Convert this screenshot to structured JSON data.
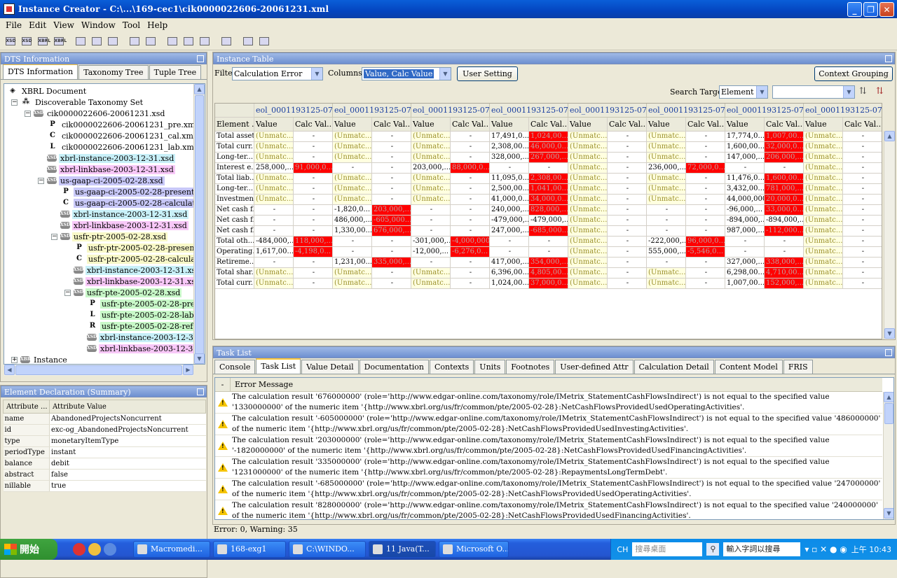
{
  "window": {
    "title": "Instance Creator - C:\\...\\169-cec1\\cik0000022606-20061231.xml"
  },
  "menu": [
    "File",
    "Edit",
    "View",
    "Window",
    "Tool",
    "Help"
  ],
  "toolbar": [
    {
      "icon": "xsd-icon",
      "label": "XSD"
    },
    {
      "icon": "xsd-new-icon",
      "label": "XSD"
    },
    {
      "icon": "xbrl-icon",
      "label": "XBRL"
    },
    {
      "icon": "xbrl-new-icon",
      "label": "XBRL"
    },
    {
      "icon": "save-icon",
      "label": ""
    },
    {
      "icon": "print-icon",
      "label": ""
    },
    {
      "icon": "validate-icon",
      "label": ""
    },
    {
      "icon": "undo-icon",
      "label": ""
    },
    {
      "icon": "redo-icon",
      "label": ""
    },
    {
      "icon": "add-element-icon",
      "label": ""
    },
    {
      "icon": "add-context-icon",
      "label": ""
    },
    {
      "icon": "add-unit-icon",
      "label": ""
    },
    {
      "icon": "inspect-icon",
      "label": ""
    },
    {
      "icon": "import-icon",
      "label": ""
    },
    {
      "icon": "export-icon",
      "label": ""
    }
  ],
  "dts": {
    "pane_title": "DTS Information",
    "tabs": [
      "DTS Information",
      "Taxonomy Tree",
      "Tuple Tree"
    ],
    "tree": [
      {
        "label": "XBRL Document",
        "icon": "xbrl-document-icon",
        "glyph": "◈",
        "indent": 0,
        "hl": ""
      },
      {
        "label": "Discoverable Taxonomy Set",
        "icon": "taxonomy-set-icon",
        "glyph": "⁂",
        "indent": 1,
        "hl": ""
      },
      {
        "label": "cik0000022606-20061231.xsd",
        "icon": "xsd-file-icon",
        "glyph": "XSD",
        "indent": 2,
        "hl": ""
      },
      {
        "label": "cik0000022606-20061231_pre.xml",
        "icon": "presentation-linkbase-icon",
        "glyph": "P",
        "indent": 3,
        "hl": ""
      },
      {
        "label": "cik0000022606-20061231_cal.xml",
        "icon": "calculation-linkbase-icon",
        "glyph": "C",
        "indent": 3,
        "hl": ""
      },
      {
        "label": "cik0000022606-20061231_lab.xml",
        "icon": "label-linkbase-icon",
        "glyph": "L",
        "indent": 3,
        "hl": ""
      },
      {
        "label": "xbrl-instance-2003-12-31.xsd",
        "icon": "xsd-file-icon",
        "glyph": "XSD",
        "indent": 3,
        "hl": "c"
      },
      {
        "label": "xbrl-linkbase-2003-12-31.xsd",
        "icon": "xsd-file-icon",
        "glyph": "XSD",
        "indent": 3,
        "hl": "m"
      },
      {
        "label": "us-gaap-ci-2005-02-28.xsd",
        "icon": "xsd-file-icon",
        "glyph": "XSD",
        "indent": 3,
        "hl": "b"
      },
      {
        "label": "us-gaap-ci-2005-02-28-presentation.xml",
        "icon": "presentation-linkbase-icon",
        "glyph": "P",
        "indent": 4,
        "hl": "b"
      },
      {
        "label": "us-gaap-ci-2005-02-28-calculation.xml",
        "icon": "calculation-linkbase-icon",
        "glyph": "C",
        "indent": 4,
        "hl": "b"
      },
      {
        "label": "xbrl-instance-2003-12-31.xsd",
        "icon": "xsd-file-icon",
        "glyph": "XSD",
        "indent": 4,
        "hl": "c"
      },
      {
        "label": "xbrl-linkbase-2003-12-31.xsd",
        "icon": "xsd-file-icon",
        "glyph": "XSD",
        "indent": 4,
        "hl": "m"
      },
      {
        "label": "usfr-ptr-2005-02-28.xsd",
        "icon": "xsd-file-icon",
        "glyph": "XSD",
        "indent": 4,
        "hl": "y"
      },
      {
        "label": "usfr-ptr-2005-02-28-presentation.xml",
        "icon": "presentation-linkbase-icon",
        "glyph": "P",
        "indent": 5,
        "hl": "y"
      },
      {
        "label": "usfr-ptr-2005-02-28-calculation.xml",
        "icon": "calculation-linkbase-icon",
        "glyph": "C",
        "indent": 5,
        "hl": "y"
      },
      {
        "label": "xbrl-instance-2003-12-31.xsd",
        "icon": "xsd-file-icon",
        "glyph": "XSD",
        "indent": 5,
        "hl": "c"
      },
      {
        "label": "xbrl-linkbase-2003-12-31.xsd",
        "icon": "xsd-file-icon",
        "glyph": "XSD",
        "indent": 5,
        "hl": "m"
      },
      {
        "label": "usfr-pte-2005-02-28.xsd",
        "icon": "xsd-file-icon",
        "glyph": "XSD",
        "indent": 5,
        "hl": "g"
      },
      {
        "label": "usfr-pte-2005-02-28-presentation.xml",
        "icon": "presentation-linkbase-icon",
        "glyph": "P",
        "indent": 6,
        "hl": "g"
      },
      {
        "label": "usfr-pte-2005-02-28-label.xml",
        "icon": "label-linkbase-icon",
        "glyph": "L",
        "indent": 6,
        "hl": "g"
      },
      {
        "label": "usfr-pte-2005-02-28-reference.xml",
        "icon": "reference-linkbase-icon",
        "glyph": "R",
        "indent": 6,
        "hl": "g"
      },
      {
        "label": "xbrl-instance-2003-12-31.xsd",
        "icon": "xsd-file-icon",
        "glyph": "XSD",
        "indent": 6,
        "hl": "c"
      },
      {
        "label": "xbrl-linkbase-2003-12-31.xsd",
        "icon": "xsd-file-icon",
        "glyph": "XSD",
        "indent": 6,
        "hl": "m"
      },
      {
        "label": "Instance",
        "icon": "xbrl-instance-icon",
        "glyph": "XBRL",
        "indent": 1,
        "hl": ""
      }
    ]
  },
  "declaration": {
    "pane_title": "Element Declaration (Summary)",
    "col_headers": [
      "Attribute ...",
      "Attribute Value"
    ],
    "rows": [
      [
        "name",
        "AbandonedProjectsNoncurrent"
      ],
      [
        "id",
        "exc-og_AbandonedProjectsNoncurrent"
      ],
      [
        "type",
        "monetaryItemType"
      ],
      [
        "periodType",
        "instant"
      ],
      [
        "balance",
        "debit"
      ],
      [
        "abstract",
        "false"
      ],
      [
        "nillable",
        "true"
      ]
    ]
  },
  "instance": {
    "pane_title": "Instance Table",
    "filter_label": "Filter",
    "filter_value": "Calculation Error",
    "columns_label": "Columns",
    "columns_value": "Value, Calc Value",
    "user_setting": "User Setting",
    "context_grouping": "Context Grouping",
    "search_target_label": "Search Target",
    "search_target_value": "Element",
    "search_value": "",
    "context_header": "eol_0001193125-07...",
    "element_header": "Element ...",
    "value_header": "Value",
    "calc_header": "Calc Val...",
    "rows": [
      {
        "el": "Total assets",
        "cells": [
          "U",
          "-",
          "U",
          "-",
          "U",
          "-",
          "17,491,0...",
          "R1,024,00...",
          "U",
          "-",
          "U",
          "-",
          "17,774,0...",
          "R1,007,00..."
        ]
      },
      {
        "el": "Total curr...",
        "cells": [
          "U",
          "-",
          "U",
          "-",
          "U",
          "-",
          "2,308,00...",
          "R46,000,0...",
          "U",
          "-",
          "U",
          "-",
          "1,600,00...",
          "R32,000,0..."
        ]
      },
      {
        "el": "Long-ter...",
        "cells": [
          "U",
          "-",
          "U",
          "-",
          "U",
          "-",
          "328,000,...",
          "R267,000,...",
          "U",
          "-",
          "U",
          "-",
          "147,000,...",
          "R206,000,..."
        ]
      },
      {
        "el": "Interest e...",
        "cells": [
          "258,000,...",
          "R91,000,0...",
          "-",
          "-",
          "203,000,...",
          "R88,000,0...",
          "-",
          "-",
          "U",
          "-",
          "236,000,...",
          "R72,000,0...",
          "-",
          "-",
          "U",
          "-"
        ]
      },
      {
        "el": "Total liab...",
        "cells": [
          "U",
          "-",
          "U",
          "-",
          "U",
          "-",
          "11,095,0...",
          "R2,308,00...",
          "U",
          "-",
          "U",
          "-",
          "11,476,0...",
          "R1,600,00..."
        ]
      },
      {
        "el": "Long-ter...",
        "cells": [
          "U",
          "-",
          "U",
          "-",
          "U",
          "-",
          "2,500,00...",
          "R1,041,00...",
          "U",
          "-",
          "U",
          "-",
          "3,432,00...",
          "R781,000,..."
        ]
      },
      {
        "el": "Investments",
        "cells": [
          "U",
          "-",
          "U",
          "-",
          "U",
          "-",
          "41,000,0...",
          "R34,000,0...",
          "U",
          "-",
          "U",
          "-",
          "44,000,000",
          "R20,000,0..."
        ]
      },
      {
        "el": "Net cash f...",
        "cells": [
          "-",
          "-",
          "-1,820,0...",
          "R203,000,...",
          "-",
          "-",
          "240,000,...",
          "R828,000,...",
          "U",
          "-",
          "-",
          "-",
          "-96,000,...",
          "R33,000,0...",
          "U",
          "-"
        ]
      },
      {
        "el": "Net cash f...",
        "cells": [
          "-",
          "-",
          "486,000,...",
          "R-605,000...",
          "-",
          "-",
          "-479,000,...",
          "-479,000,...",
          "U",
          "-",
          "-",
          "-",
          "-894,000,...",
          "-894,000,...",
          "U",
          "-"
        ]
      },
      {
        "el": "Net cash f...",
        "cells": [
          "-",
          "-",
          "1,330,00...",
          "R676,000,...",
          "-",
          "-",
          "247,000,...",
          "R-685,000...",
          "U",
          "-",
          "-",
          "-",
          "987,000,...",
          "R-112,000...",
          "U",
          "-"
        ]
      },
      {
        "el": "Total oth...",
        "cells": [
          "-484,000,...",
          "R118,000,...",
          "-",
          "-",
          "-301,000,...",
          "R-4,000,000",
          "-",
          "-",
          "U",
          "-",
          "-222,000,...",
          "R96,000,0...",
          "-",
          "-",
          "U",
          "-"
        ]
      },
      {
        "el": "Operating...",
        "cells": [
          "1,617,00...",
          "R-4,198,0...",
          "-",
          "-",
          "-12,000,...",
          "R-6,276,0...",
          "-",
          "-",
          "U",
          "-",
          "555,000,...",
          "R-5,546,0...",
          "-",
          "-",
          "U",
          "-"
        ]
      },
      {
        "el": "Retireme...",
        "cells": [
          "-",
          "-",
          "1,231,00...",
          "R335,000,...",
          "-",
          "-",
          "417,000,...",
          "R354,000,...",
          "U",
          "-",
          "-",
          "-",
          "327,000,...",
          "R338,000,...",
          "U",
          "-"
        ]
      },
      {
        "el": "Total shar...",
        "cells": [
          "U",
          "-",
          "U",
          "-",
          "U",
          "-",
          "6,396,00...",
          "R4,805,00...",
          "U",
          "-",
          "U",
          "-",
          "6,298,00...",
          "R4,710,00..."
        ]
      },
      {
        "el": "Total curr...",
        "cells": [
          "U",
          "-",
          "U",
          "-",
          "U",
          "-",
          "1,024,00...",
          "R37,000,0...",
          "U",
          "-",
          "U",
          "-",
          "1,007,00...",
          "R152,000,..."
        ]
      }
    ],
    "unmatched": "(Unmatc..."
  },
  "tasks": {
    "pane_title": "Task List",
    "tabs": [
      "Console",
      "Task List",
      "Value Detail",
      "Documentation",
      "Contexts",
      "Units",
      "Footnotes",
      "User-defined Attr",
      "Calculation Detail",
      "Content Model",
      "FRIS"
    ],
    "active_tab": "Task List",
    "col_dash": "-",
    "col_header": "Error Message",
    "messages": [
      "The calculation result '676000000' (role='http://www.edgar-online.com/taxonomy/role/IMetrix_StatementCashFlowsIndirect') is not equal to the specified value '1330000000' of the numeric item '{http://www.xbrl.org/us/fr/common/pte/2005-02-28}:NetCashFlowsProvidedUsedOperatingActivities'.",
      "The calculation result '-605000000' (role='http://www.edgar-online.com/taxonomy/role/IMetrix_StatementCashFlowsIndirect') is not equal to the specified value '486000000' of the numeric item '{http://www.xbrl.org/us/fr/common/pte/2005-02-28}:NetCashFlowsProvidedUsedInvestingActivities'.",
      "The calculation result '203000000' (role='http://www.edgar-online.com/taxonomy/role/IMetrix_StatementCashFlowsIndirect') is not equal to the specified value '-1820000000' of the numeric item '{http://www.xbrl.org/us/fr/common/pte/2005-02-28}:NetCashFlowsProvidedUsedFinancingActivities'.",
      "The calculation result '335000000' (role='http://www.edgar-online.com/taxonomy/role/IMetrix_StatementCashFlowsIndirect') is not equal to the specified value '1231000000' of the numeric item '{http://www.xbrl.org/us/fr/common/pte/2005-02-28}:RepaymentsLongTermDebt'.",
      "The calculation result '-685000000' (role='http://www.edgar-online.com/taxonomy/role/IMetrix_StatementCashFlowsIndirect') is not equal to the specified value '247000000' of the numeric item '{http://www.xbrl.org/us/fr/common/pte/2005-02-28}:NetCashFlowsProvidedUsedOperatingActivities'.",
      "The calculation result '828000000' (role='http://www.edgar-online.com/taxonomy/role/IMetrix_StatementCashFlowsIndirect') is not equal to the specified value '240000000' of the numeric item '{http://www.xbrl.org/us/fr/common/pte/2005-02-28}:NetCashFlowsProvidedUsedFinancingActivities'."
    ],
    "status": "Error: 0, Warning: 35"
  },
  "taskbar": {
    "start": "開始",
    "items": [
      "Macromedi...",
      "168-exg1",
      "C:\\WINDO...",
      "11 Java(T...",
      "Microsoft O..."
    ],
    "lang": "CH",
    "search_desktop": "搜尋桌面",
    "search_web": "輸入字詞以搜尋",
    "clock": "上午 10:43"
  }
}
